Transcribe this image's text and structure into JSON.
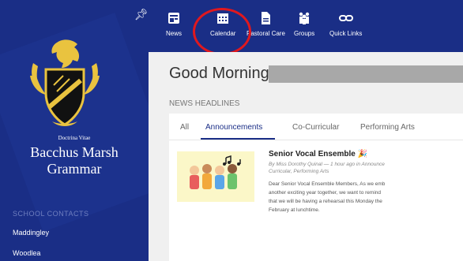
{
  "sidebar": {
    "motto": "Doctrina Vitae",
    "school_name_line1": "Bacchus Marsh",
    "school_name_line2": "Grammar",
    "contacts_title": "SCHOOL CONTACTS",
    "contacts": [
      "Maddingley",
      "Woodlea"
    ]
  },
  "nav": {
    "items": [
      {
        "label": "News",
        "icon": "news-icon"
      },
      {
        "label": "Calendar",
        "icon": "calendar-icon"
      },
      {
        "label": "Pastoral Care",
        "icon": "document-icon"
      },
      {
        "label": "Groups",
        "icon": "groups-icon"
      },
      {
        "label": "Quick Links",
        "icon": "link-icon"
      }
    ]
  },
  "main": {
    "greeting": "Good Morning,",
    "news_title": "NEWS HEADLINES",
    "tabs": [
      "All",
      "Announcements",
      "Co-Curricular",
      "Performing Arts"
    ],
    "active_tab": "Announcements",
    "article": {
      "title": "Senior Vocal Ensemble 🎉",
      "meta_line1": "By Miss Dorothy Quinal — 1 hour ago in Announce",
      "meta_line2": "Curricular, Performing Arts",
      "body_line1": "Dear Senior Vocal Ensemble Members, As we emb",
      "body_line2": "another exciting year together, we want to remind",
      "body_line3": "that we will be having a rehearsal this Monday the",
      "body_line4": "February at lunchtime."
    }
  },
  "colors": {
    "brand_blue": "#1a2e86",
    "highlight_red": "#e0181e",
    "crest_gold": "#e9c33f"
  }
}
